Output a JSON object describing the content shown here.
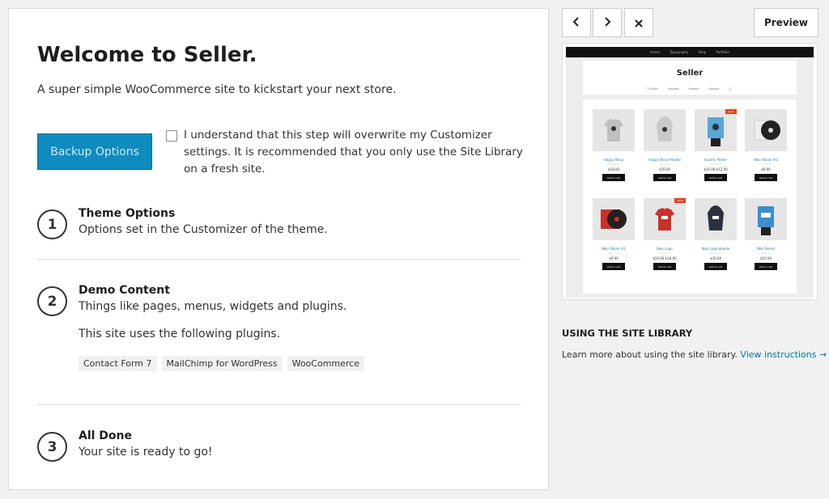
{
  "main": {
    "title": "Welcome to Seller.",
    "subtitle": "A super simple WooCommerce site to kickstart your next store.",
    "backup_label": "Backup Options",
    "agree_text": "I understand that this step will overwrite my Customizer settings. It is recommended that you only use the Site Library on a fresh site.",
    "steps": [
      {
        "num": "1",
        "title": "Theme Options",
        "desc": "Options set in the Customizer of the theme."
      },
      {
        "num": "2",
        "title": "Demo Content",
        "desc": "Things like pages, menus, widgets and plugins.",
        "extra": "This site uses the following plugins."
      },
      {
        "num": "3",
        "title": "All Done",
        "desc": "Your site is ready to go!"
      }
    ],
    "plugins": [
      "Contact Form 7",
      "MailChimp for WordPress",
      "WooCommerce"
    ]
  },
  "toolbar": {
    "prev_icon": "‹",
    "next_icon": "›",
    "close_icon": "×",
    "preview_label": "Preview"
  },
  "thumbnail": {
    "top_menu": [
      "Home",
      "Typography",
      "Shop",
      "Portfolio"
    ],
    "brand": "Seller",
    "menu": [
      "T-Shirts",
      "Hoodies",
      "Posters",
      "Albums",
      "🛒"
    ],
    "products": [
      {
        "name": "Happy Ninja",
        "price": "$18.00",
        "sale": false,
        "icon": "tshirt"
      },
      {
        "name": "Happy Ninja Hoodie",
        "price": "$35.00",
        "sale": false,
        "icon": "hoodie"
      },
      {
        "name": "Quality Poster",
        "price": "$15.00 $12.00",
        "sale": true,
        "icon": "poster"
      },
      {
        "name": "Woo Album #1",
        "price": "$9.00",
        "sale": false,
        "icon": "album"
      },
      {
        "name": "Woo Album #2",
        "price": "$9.00",
        "sale": false,
        "icon": "album-red"
      },
      {
        "name": "Woo Logo",
        "price": "$20.00 $18.00",
        "sale": true,
        "icon": "tshirt-red"
      },
      {
        "name": "Woo Logo Hoodie",
        "price": "$35.00",
        "sale": false,
        "icon": "hoodie-dark"
      },
      {
        "name": "Woo Poster",
        "price": "$15.00",
        "sale": false,
        "icon": "poster-woo"
      }
    ],
    "cart_label": "Add to cart",
    "sale_label": "SALE",
    "stars": "★★★★★"
  },
  "library": {
    "heading": "USING THE SITE LIBRARY",
    "text": "Learn more about using the site library.",
    "link": "View instructions →"
  },
  "colors": {
    "accent": "#0f8bbf",
    "link": "#0073aa",
    "sale": "#e2401c"
  }
}
